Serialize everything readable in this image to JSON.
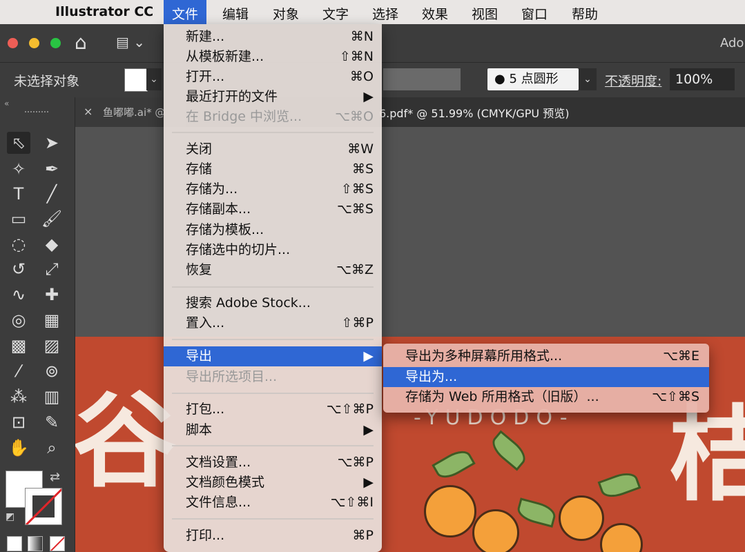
{
  "menubar": {
    "apple": "",
    "app_name": "Illustrator CC",
    "items": [
      "文件",
      "编辑",
      "对象",
      "文字",
      "选择",
      "效果",
      "视图",
      "窗口",
      "帮助"
    ]
  },
  "appbar": {
    "title_fragment": "Ado"
  },
  "control_bar": {
    "selection_status": "未选择对象",
    "brush_definition": "5 点圆形",
    "opacity_label": "不透明度:",
    "opacity_value": "100%"
  },
  "tabs": [
    {
      "label": "鱼嘟嘟.ai* @"
    },
    {
      "label": "6.pdf* @ 51.99% (CMYK/GPU 预览)"
    }
  ],
  "artwork": {
    "big_char_left": "谷",
    "big_char_right": "桔",
    "brand_text": "-YUDODO-"
  },
  "file_menu": {
    "items": [
      {
        "label": "新建...",
        "shortcut": "⌘N",
        "disabled": false
      },
      {
        "label": "从模板新建...",
        "shortcut": "⇧⌘N",
        "disabled": false
      },
      {
        "label": "打开...",
        "shortcut": "⌘O",
        "disabled": false
      },
      {
        "label": "最近打开的文件",
        "shortcut": "▶",
        "disabled": false
      },
      {
        "label": "在 Bridge 中浏览...",
        "shortcut": "⌥⌘O",
        "disabled": true
      },
      {
        "label": "关闭",
        "shortcut": "⌘W",
        "disabled": false
      },
      {
        "label": "存储",
        "shortcut": "⌘S",
        "disabled": false
      },
      {
        "label": "存储为...",
        "shortcut": "⇧⌘S",
        "disabled": false
      },
      {
        "label": "存储副本...",
        "shortcut": "⌥⌘S",
        "disabled": false
      },
      {
        "label": "存储为模板...",
        "shortcut": "",
        "disabled": false
      },
      {
        "label": "存储选中的切片...",
        "shortcut": "",
        "disabled": false
      },
      {
        "label": "恢复",
        "shortcut": "⌥⌘Z",
        "disabled": false
      },
      {
        "label": "搜索 Adobe Stock...",
        "shortcut": "",
        "disabled": false
      },
      {
        "label": "置入...",
        "shortcut": "⇧⌘P",
        "disabled": false
      },
      {
        "label": "导出",
        "shortcut": "▶",
        "disabled": false
      },
      {
        "label": "导出所选项目...",
        "shortcut": "",
        "disabled": true
      },
      {
        "label": "打包...",
        "shortcut": "⌥⇧⌘P",
        "disabled": false
      },
      {
        "label": "脚本",
        "shortcut": "▶",
        "disabled": false
      },
      {
        "label": "文档设置...",
        "shortcut": "⌥⌘P",
        "disabled": false
      },
      {
        "label": "文档颜色模式",
        "shortcut": "▶",
        "disabled": false
      },
      {
        "label": "文件信息...",
        "shortcut": "⌥⇧⌘I",
        "disabled": false
      },
      {
        "label": "打印...",
        "shortcut": "⌘P",
        "disabled": false
      }
    ]
  },
  "export_submenu": {
    "items": [
      {
        "label": "导出为多种屏幕所用格式...",
        "shortcut": "⌥⌘E"
      },
      {
        "label": "导出为...",
        "shortcut": ""
      },
      {
        "label": "存储为 Web 所用格式（旧版）...",
        "shortcut": "⌥⇧⌘S"
      }
    ]
  },
  "colors": {
    "accent": "#2f67d4",
    "artwork_red": "#c0492f",
    "panel": "#3c3c3c"
  }
}
